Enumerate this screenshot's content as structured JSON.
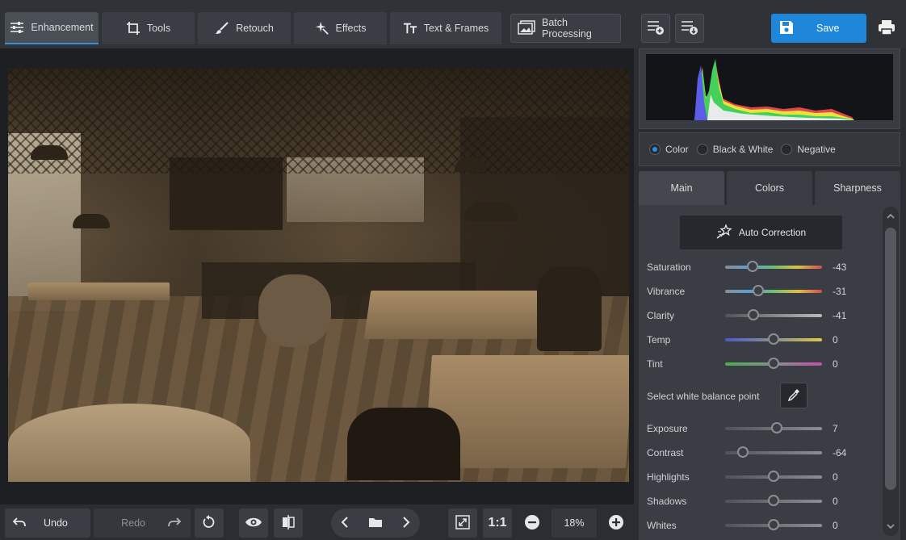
{
  "toolbar": {
    "tabs": [
      {
        "label": "Enhancement",
        "icon": "sliders-icon"
      },
      {
        "label": "Tools",
        "icon": "crop-icon"
      },
      {
        "label": "Retouch",
        "icon": "brush-icon"
      },
      {
        "label": "Effects",
        "icon": "sparkle-icon"
      },
      {
        "label": "Text & Frames",
        "icon": "text-icon"
      }
    ],
    "batch_label": "Batch Processing",
    "save_label": "Save"
  },
  "histogram_modes": {
    "color": "Color",
    "bw": "Black & White",
    "negative": "Negative",
    "selected": "Color"
  },
  "panel_tabs": [
    "Main",
    "Colors",
    "Sharpness"
  ],
  "panel": {
    "auto_label": "Auto Correction",
    "white_balance_label": "Select white balance point",
    "sliders": [
      {
        "label": "Saturation",
        "value": "-43",
        "level": -43
      },
      {
        "label": "Vibrance",
        "value": "-31",
        "level": -31
      },
      {
        "label": "Clarity",
        "value": "-41",
        "level": -41
      },
      {
        "label": "Temp",
        "value": "0",
        "level": 0
      },
      {
        "label": "Tint",
        "value": "0",
        "level": 0
      }
    ],
    "sliders2": [
      {
        "label": "Exposure",
        "value": "7",
        "level": 7
      },
      {
        "label": "Contrast",
        "value": "-64",
        "level": -64
      },
      {
        "label": "Highlights",
        "value": "0",
        "level": 0
      },
      {
        "label": "Shadows",
        "value": "0",
        "level": 0
      },
      {
        "label": "Whites",
        "value": "0",
        "level": 0
      }
    ]
  },
  "bottom": {
    "undo_label": "Undo",
    "redo_label": "Redo",
    "one_to_one": "1:1",
    "zoom": "18%"
  }
}
